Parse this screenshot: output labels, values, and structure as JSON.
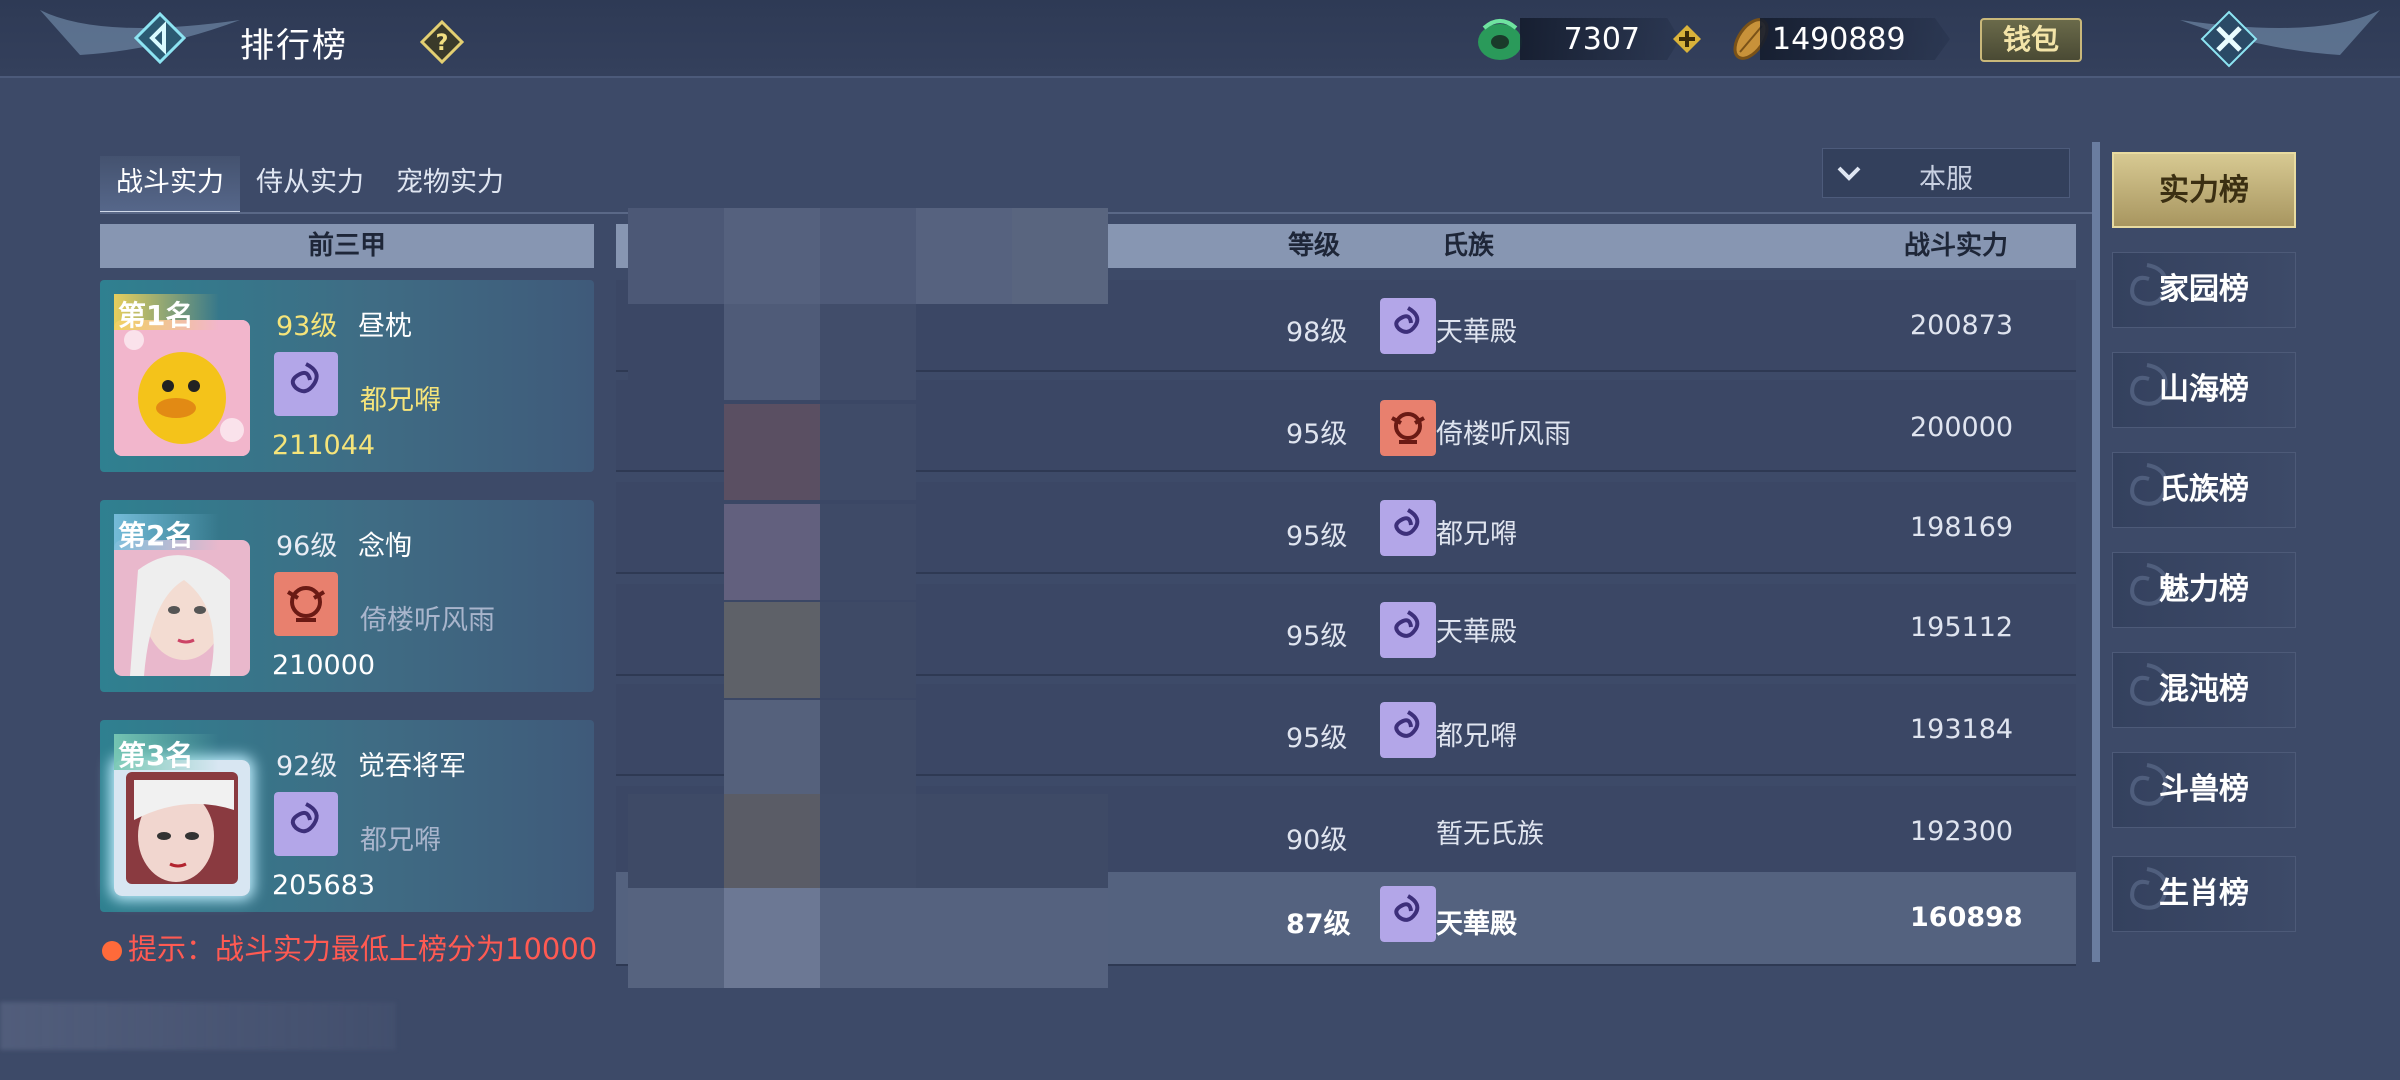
{
  "header": {
    "title": "排行榜",
    "jade_amount": "7307",
    "coin_amount": "1490889",
    "wallet_label": "钱包"
  },
  "tabs": [
    {
      "label": "战斗实力",
      "active": true
    },
    {
      "label": "侍从实力",
      "active": false
    },
    {
      "label": "宠物实力",
      "active": false
    }
  ],
  "server_select": {
    "label": "本服"
  },
  "top3": {
    "header": "前三甲",
    "cards": [
      {
        "rank": "第1名",
        "level": "93级",
        "name": "昼枕",
        "clan": "都兄嘚",
        "power": "211044"
      },
      {
        "rank": "第2名",
        "level": "96级",
        "name": "念恂",
        "clan": "倚楼听风雨",
        "power": "210000"
      },
      {
        "rank": "第3名",
        "level": "92级",
        "name": "觉吞将军",
        "clan": "都兄嘚",
        "power": "205683"
      }
    ]
  },
  "tip": "提示：战斗实力最低上榜分为10000",
  "table": {
    "headers": {
      "level": "等级",
      "clan": "氏族",
      "power": "战斗实力"
    },
    "rows": [
      {
        "level": "98级",
        "clan": "天華殿",
        "power": "200873",
        "clan_icon": "purple"
      },
      {
        "level": "95级",
        "clan": "倚楼听风雨",
        "power": "200000",
        "clan_icon": "red"
      },
      {
        "level": "95级",
        "clan": "都兄嘚",
        "power": "198169",
        "clan_icon": "purple"
      },
      {
        "level": "95级",
        "clan": "天華殿",
        "power": "195112",
        "clan_icon": "purple"
      },
      {
        "level": "95级",
        "clan": "都兄嘚",
        "power": "193184",
        "clan_icon": "purple"
      },
      {
        "level": "90级",
        "clan": "暂无氏族",
        "power": "192300",
        "clan_icon": "none"
      },
      {
        "level": "87级",
        "clan": "天華殿",
        "power": "160898",
        "clan_icon": "purple",
        "highlight": true
      }
    ]
  },
  "right_nav": [
    {
      "label": "实力榜",
      "active": true
    },
    {
      "label": "家园榜"
    },
    {
      "label": "山海榜"
    },
    {
      "label": "氏族榜"
    },
    {
      "label": "魅力榜"
    },
    {
      "label": "混沌榜"
    },
    {
      "label": "斗兽榜"
    },
    {
      "label": "生肖榜"
    }
  ],
  "colors": {
    "accent_gold": "#d7c992",
    "tip_red": "#ff5a52",
    "level_yellow": "#f5e47a",
    "clan_purple": "#b3a6e8",
    "clan_red": "#e8806e"
  }
}
